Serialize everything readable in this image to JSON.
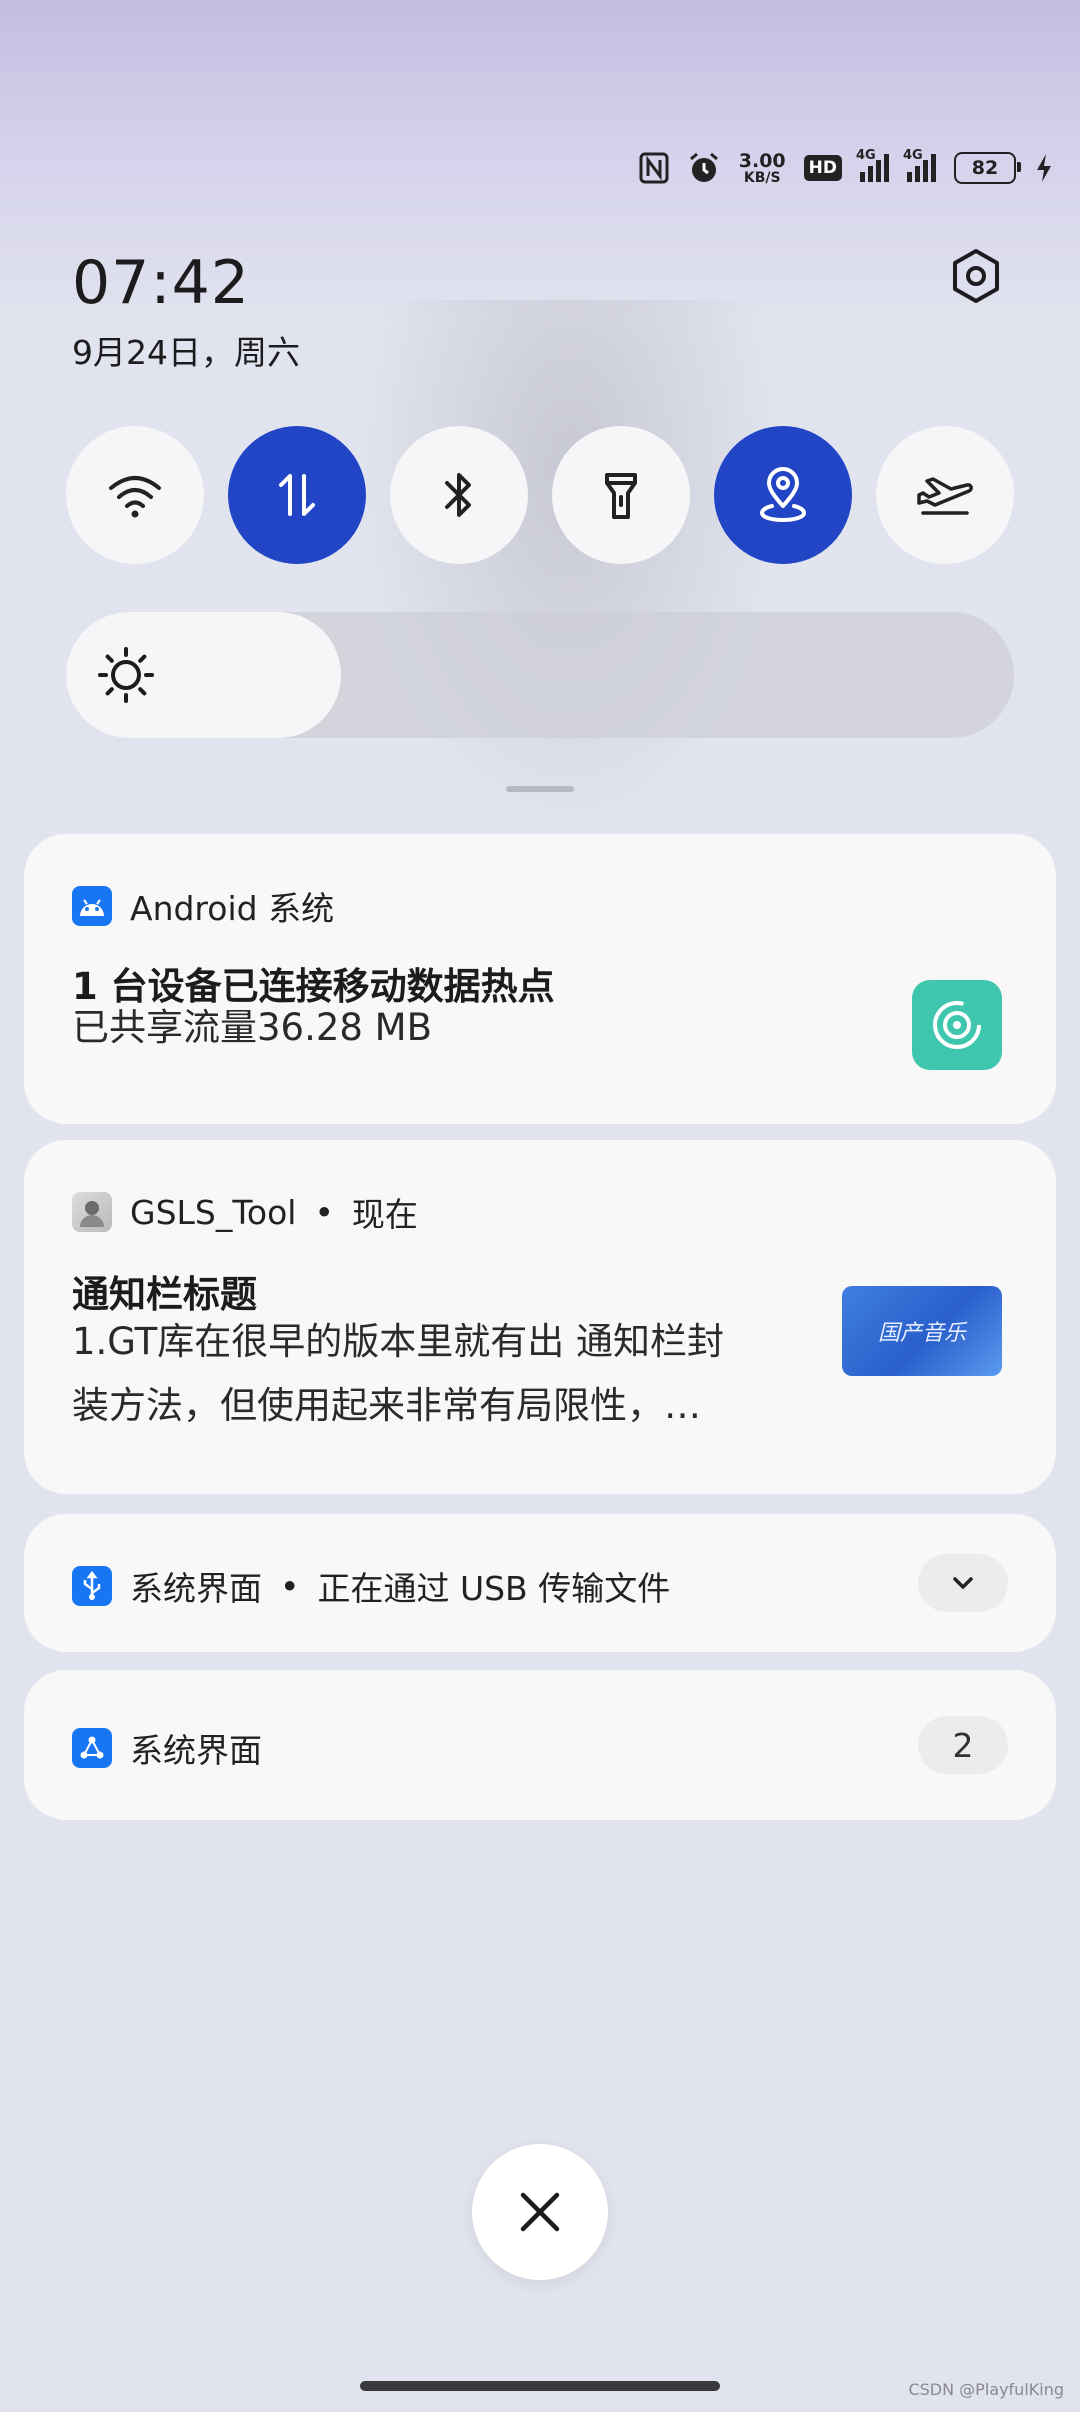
{
  "status_bar": {
    "speed_value": "3.00",
    "speed_unit": "KB/S",
    "hd_label": "HD",
    "sim1_label": "4G",
    "sim2_label": "4G",
    "battery": "82",
    "icons": [
      "nfc-icon",
      "alarm-icon",
      "hd-voice-icon",
      "signal-icon",
      "signal-icon",
      "battery-icon",
      "charging-icon"
    ]
  },
  "header": {
    "time": "07:42",
    "date": "9月24日，周六"
  },
  "quick_toggles": [
    {
      "name": "wifi",
      "icon": "wifi-icon",
      "on": false
    },
    {
      "name": "mobile-data",
      "icon": "mobile-data-icon",
      "on": true
    },
    {
      "name": "bluetooth",
      "icon": "bluetooth-icon",
      "on": false
    },
    {
      "name": "flashlight",
      "icon": "flashlight-icon",
      "on": false
    },
    {
      "name": "location",
      "icon": "location-icon",
      "on": true
    },
    {
      "name": "airplane-mode",
      "icon": "airplane-icon",
      "on": false
    }
  ],
  "brightness": {
    "level": 0.29
  },
  "notifications": [
    {
      "app": "Android 系统",
      "title": "1 台设备已连接移动数据热点",
      "body": "已共享流量36.28 MB"
    },
    {
      "app": "GSLS_Tool",
      "time": "现在",
      "title": "通知栏标题",
      "body_line1": "1.GT库在很早的版本里就有出 通知栏封",
      "body_line2": "装方法，但使用起来非常有局限性，…",
      "thumb_text": "国产音乐"
    },
    {
      "app": "系统界面",
      "summary": "正在通过 USB 传输文件"
    },
    {
      "app": "系统界面",
      "count": "2"
    }
  ],
  "watermark": "CSDN @PlayfulKing",
  "colors": {
    "accent": "#2145c4",
    "app_icon_blue": "#1976f2",
    "hotspot_green": "#3fc6ae"
  }
}
